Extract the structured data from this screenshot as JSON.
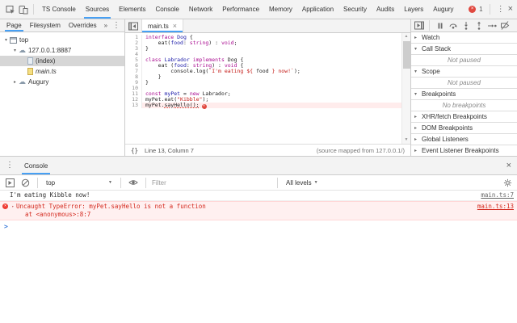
{
  "window": {
    "error_count": "1"
  },
  "icons": {
    "kebab": "⋮",
    "close": "×",
    "dropdown": "▼",
    "scroll_up": "▲",
    "scroll_down": "▼"
  },
  "main_toolbar": {
    "tabs": [
      "TS Console",
      "Sources",
      "Elements",
      "Console",
      "Network",
      "Performance",
      "Memory",
      "Application",
      "Security",
      "Audits",
      "Layers",
      "Augury"
    ],
    "active": "Sources"
  },
  "navigator": {
    "tabs": [
      "Page",
      "Filesystem",
      "Overrides"
    ],
    "active": "Page",
    "more_label": "»",
    "tree": [
      {
        "label": "top",
        "icon": "frame",
        "depth": 0,
        "arrow": "open"
      },
      {
        "label": "127.0.0.1:8887",
        "icon": "cloud",
        "depth": 1,
        "arrow": "open"
      },
      {
        "label": "(index)",
        "icon": "doc",
        "depth": 2,
        "selected": true
      },
      {
        "label": "main.ts",
        "icon": "doc-script",
        "depth": 2,
        "italic": true
      },
      {
        "label": "Augury",
        "icon": "cloud",
        "depth": 1,
        "arrow": "closed"
      }
    ]
  },
  "editor": {
    "tab": {
      "label": "main.ts",
      "close": "×"
    },
    "status": {
      "pretty_print": "{}",
      "position": "Line 13, Column 7",
      "source_map": "(source mapped from 127.0.0.1/)"
    },
    "code": [
      {
        "n": 1,
        "tokens": [
          [
            "kw",
            "interface"
          ],
          [
            "pl",
            " "
          ],
          [
            "df",
            "Dog"
          ],
          [
            "pl",
            " {"
          ]
        ]
      },
      {
        "n": 2,
        "tokens": [
          [
            "pl",
            "    eat("
          ],
          [
            "df",
            "food"
          ],
          [
            "pl",
            ": "
          ],
          [
            "kw",
            "string"
          ],
          [
            "pl",
            ") : "
          ],
          [
            "kw",
            "void"
          ],
          [
            "pl",
            ";"
          ]
        ]
      },
      {
        "n": 3,
        "tokens": [
          [
            "pl",
            "}"
          ]
        ]
      },
      {
        "n": 4,
        "tokens": []
      },
      {
        "n": 5,
        "tokens": [
          [
            "kw",
            "class"
          ],
          [
            "pl",
            " "
          ],
          [
            "df",
            "Labrador"
          ],
          [
            "pl",
            " "
          ],
          [
            "kw",
            "implements"
          ],
          [
            "pl",
            " Dog {"
          ]
        ]
      },
      {
        "n": 6,
        "tokens": [
          [
            "pl",
            "    eat ("
          ],
          [
            "df",
            "food"
          ],
          [
            "pl",
            ": "
          ],
          [
            "kw",
            "string"
          ],
          [
            "pl",
            ") : "
          ],
          [
            "kw",
            "void"
          ],
          [
            "pl",
            " {"
          ]
        ]
      },
      {
        "n": 7,
        "tokens": [
          [
            "pl",
            "        console.log("
          ],
          [
            "st",
            "`I'm eating ${ "
          ],
          [
            "pl",
            "food"
          ],
          [
            "st",
            " } now!`"
          ],
          [
            "pl",
            ");"
          ]
        ]
      },
      {
        "n": 8,
        "tokens": [
          [
            "pl",
            "    }"
          ]
        ]
      },
      {
        "n": 9,
        "tokens": [
          [
            "pl",
            "}"
          ]
        ]
      },
      {
        "n": 10,
        "tokens": []
      },
      {
        "n": 11,
        "tokens": [
          [
            "kw",
            "const"
          ],
          [
            "pl",
            " "
          ],
          [
            "df",
            "myPet"
          ],
          [
            "pl",
            " = "
          ],
          [
            "kw",
            "new"
          ],
          [
            "pl",
            " Labrador;"
          ]
        ]
      },
      {
        "n": 12,
        "tokens": [
          [
            "pl",
            "myPet.eat("
          ],
          [
            "st",
            "\"Kibble\""
          ],
          [
            "pl",
            ");"
          ]
        ]
      },
      {
        "n": 13,
        "tokens": [
          [
            "pl",
            "myPet."
          ],
          [
            "er",
            "sayHello();"
          ]
        ],
        "error": true
      }
    ]
  },
  "debugger": {
    "sections": [
      {
        "label": "Watch",
        "arrow": "closed"
      },
      {
        "label": "Call Stack",
        "arrow": "open",
        "body": "Not paused"
      },
      {
        "label": "Scope",
        "arrow": "open",
        "body": "Not paused"
      },
      {
        "label": "Breakpoints",
        "arrow": "open",
        "body": "No breakpoints"
      },
      {
        "label": "XHR/fetch Breakpoints",
        "arrow": "closed"
      },
      {
        "label": "DOM Breakpoints",
        "arrow": "closed"
      },
      {
        "label": "Global Listeners",
        "arrow": "closed"
      },
      {
        "label": "Event Listener Breakpoints",
        "arrow": "closed"
      }
    ]
  },
  "console": {
    "tab_label": "Console",
    "context_selector": "top",
    "filter_placeholder": "Filter",
    "levels_label": "All levels",
    "prompt": ">",
    "messages": [
      {
        "type": "log",
        "text": "I'm eating Kibble now!",
        "link": "main.ts:7"
      },
      {
        "type": "error",
        "text": "Uncaught TypeError: myPet.sayHello is not a function",
        "stack": "at <anonymous>:8:7",
        "link": "main.ts:13"
      }
    ]
  },
  "colors": {
    "accent": "#47a0f4",
    "kw": "#aa0d91",
    "def": "#1a1aa8",
    "str": "#c41a16",
    "err": "#d42a1f",
    "err-bg": "#fff0f0",
    "err-border": "#ffd7d7",
    "err-line": "#ffecec"
  }
}
